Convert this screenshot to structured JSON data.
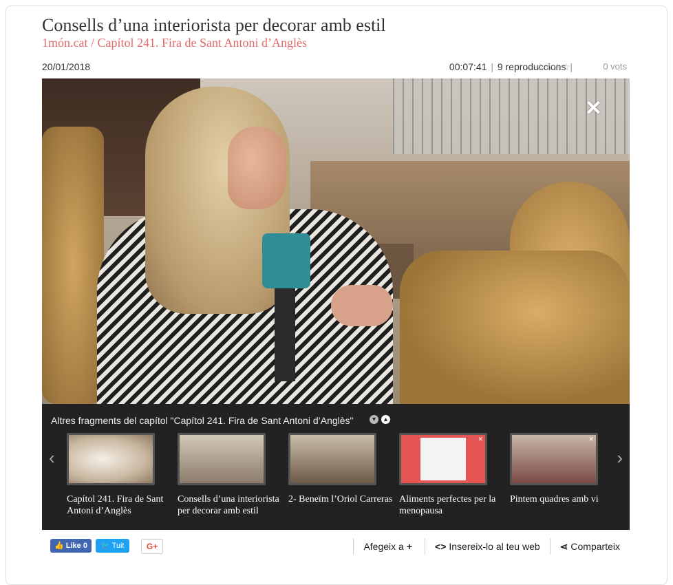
{
  "header": {
    "title": "Consells d’una interiorista per decorar amb estil",
    "source": "1món.cat",
    "separator": " / ",
    "chapter": "Capítol 241. Fira de Sant Antoni d’Anglès"
  },
  "meta": {
    "date": "20/01/2018",
    "duration": "00:07:41",
    "plays": "9 reproduccions",
    "rating_stars": "☆☆☆☆☆",
    "votes": "0 vots"
  },
  "video": {
    "logo_text": "✕"
  },
  "fragments": {
    "title": "Altres fragments del capítol \"Capítol 241. Fira de Sant Antoni d’Anglès\"",
    "prev_icon": "‹",
    "next_icon": "›",
    "items": [
      {
        "label": "Capítol 241. Fira de Sant Antoni d’Anglès"
      },
      {
        "label": "Consells d’una interiorista per decorar amb estil"
      },
      {
        "label": "2- Beneïm l’Oriol Carreras"
      },
      {
        "label": "Aliments perfectes per la menopausa"
      },
      {
        "label": "Pintem quadres amb vi"
      }
    ]
  },
  "footer": {
    "facebook": "Like 0",
    "twitter": "Tuit",
    "google": "G+",
    "add_label": "Afegeix a",
    "embed_label": "Insereix-lo al teu web",
    "share_label": "Comparteix"
  },
  "colors": {
    "accent": "#e46a6a",
    "panel": "#222222",
    "facebook": "#4267b2",
    "twitter": "#1da1f2"
  }
}
